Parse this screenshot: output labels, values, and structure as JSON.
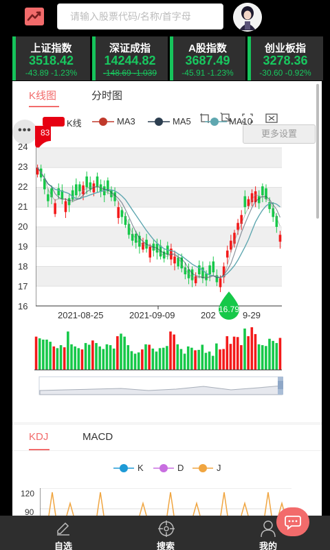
{
  "header": {
    "search_placeholder": "请输入股票代码/名称/首字母",
    "logo_icon": "trend-chart-icon",
    "avatar_icon": "user-avatar-icon"
  },
  "indices": [
    {
      "name": "上证指数",
      "value": "3518.42",
      "change": "-43.89 -1.23%"
    },
    {
      "name": "深证成指",
      "value": "14244.82",
      "change": "-148.69 -1.039"
    },
    {
      "name": "A股指数",
      "value": "3687.49",
      "change": "-45.91 -1.23%"
    },
    {
      "name": "创业板指",
      "value": "3278.36",
      "change": "-30.60 -0.92%"
    }
  ],
  "chart_tabs": {
    "active": "K线图",
    "other": "分时图"
  },
  "legend": {
    "k": "K线",
    "ma3": "MA3",
    "ma5": "MA5",
    "ma10": "MA10",
    "more_settings": "更多设置",
    "more_dots": "•••",
    "price_marker_partial": "83",
    "toolbar_icons": [
      "zoom-select-icon",
      "zoom-reset-icon",
      "fullscreen-icon",
      "screenshot-icon"
    ]
  },
  "colors": {
    "up": "#f31a1a",
    "down": "#16c849",
    "accent": "#f26b6b",
    "ma3": "#c0392b",
    "ma5": "#2c3e50",
    "ma10": "#5fa7b0",
    "k": "#1e9ad6",
    "d": "#c86ee0",
    "j": "#f0a540"
  },
  "chart_data": [
    {
      "type": "candlestick",
      "ylim": [
        16,
        24
      ],
      "y_ticks": [
        "24",
        "23",
        "22",
        "21",
        "20",
        "19",
        "18",
        "17",
        "16"
      ],
      "x_ticks": [
        "2021-08-25",
        "2021-09-09",
        "2021-09-29"
      ],
      "x_tick_visible": [
        "2021-08-25",
        "2021-09-09",
        "202",
        "9-29"
      ],
      "min_label": "16.79",
      "series_close": [
        23.0,
        22.5,
        21.9,
        21.3,
        21.5,
        21.2,
        21.6,
        21.4,
        21.3,
        21.1,
        21.4,
        21.6,
        21.8,
        22.1,
        22.0,
        21.9,
        22.2,
        22.0,
        21.8,
        21.6,
        21.8,
        21.5,
        21.3,
        21.0,
        20.5,
        20.1,
        19.6,
        19.3,
        19.2,
        19.0,
        19.2,
        18.9,
        19.0,
        18.8,
        18.7,
        18.5,
        18.4,
        18.6,
        18.9,
        18.5,
        18.0,
        17.9,
        17.6,
        17.4,
        17.3,
        17.5,
        17.6,
        17.4,
        17.3,
        17.6,
        17.7,
        17.2,
        17.4,
        18.0,
        18.8,
        19.3,
        19.7,
        20.2,
        20.6,
        21.0,
        21.4,
        21.7,
        21.8,
        21.2,
        21.6,
        21.4,
        20.9,
        20.5,
        20.0,
        19.6
      ],
      "ma3_close_trend": "follows close",
      "series_names": [
        "K线",
        "MA3",
        "MA5",
        "MA10"
      ]
    },
    {
      "type": "bar",
      "name": "volume",
      "values": [
        0.78,
        0.74,
        0.71,
        0.71,
        0.66,
        0.55,
        0.51,
        0.58,
        0.53,
        0.9,
        0.6,
        0.55,
        0.51,
        0.48,
        0.63,
        0.59,
        0.69,
        0.63,
        0.55,
        0.49,
        0.6,
        0.58,
        0.5,
        0.79,
        0.85,
        0.78,
        0.58,
        0.44,
        0.38,
        0.41,
        0.48,
        0.6,
        0.59,
        0.5,
        0.43,
        0.51,
        0.52,
        0.56,
        0.9,
        0.83,
        0.6,
        0.49,
        0.38,
        0.55,
        0.52,
        0.46,
        0.47,
        0.59,
        0.4,
        0.43,
        0.33,
        0.62,
        0.48,
        0.49,
        0.79,
        0.61,
        0.78,
        0.77,
        0.58,
        0.97,
        0.79,
        1.0,
        0.84,
        0.6,
        0.58,
        0.56,
        0.73,
        0.68,
        0.63,
        0.75
      ],
      "up_flags": [
        true,
        false,
        false,
        false,
        false,
        true,
        false,
        false,
        true,
        false,
        false,
        false,
        false,
        true,
        false,
        false,
        true,
        false,
        false,
        false,
        false,
        false,
        false,
        true,
        false,
        false,
        false,
        false,
        false,
        false,
        true,
        false,
        true,
        false,
        false,
        false,
        false,
        false,
        true,
        true,
        false,
        false,
        false,
        false,
        false,
        true,
        false,
        false,
        false,
        false,
        false,
        false,
        true,
        true,
        true,
        true,
        true,
        true,
        true,
        false,
        true,
        true,
        true,
        false,
        false,
        false,
        false,
        false,
        false,
        true
      ]
    },
    {
      "type": "line",
      "name": "KDJ",
      "tabs": [
        "KDJ",
        "MACD"
      ],
      "active_tab": "KDJ",
      "legend": [
        "K",
        "D",
        "J"
      ],
      "y_ticks": [
        "120",
        "90"
      ],
      "ylim": [
        90,
        120
      ]
    }
  ],
  "bottom_nav": [
    {
      "label": "自选",
      "icon": "pencil-note-icon"
    },
    {
      "label": "搜索",
      "icon": "crosshair-search-icon"
    },
    {
      "label": "我的",
      "icon": "user-profile-icon"
    }
  ],
  "fab_icon": "chat-bubble-icon"
}
